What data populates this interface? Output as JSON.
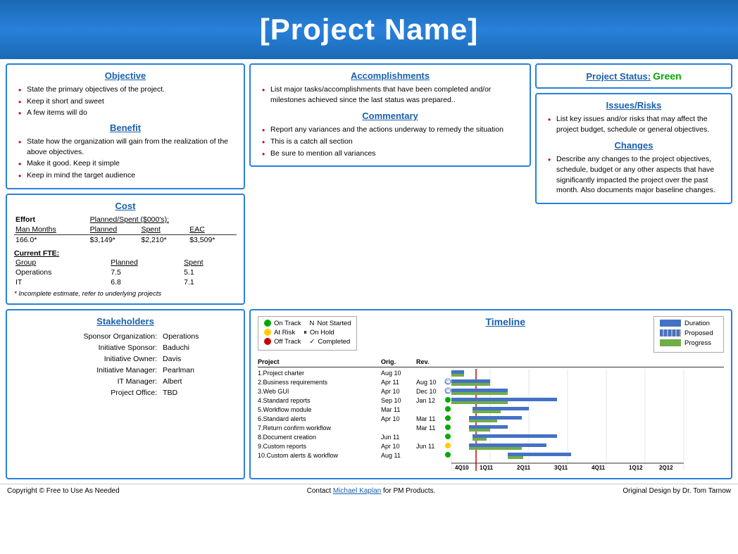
{
  "header": {
    "title": "[Project Name]"
  },
  "objective": {
    "title": "Objective",
    "items": [
      "State the primary objectives of the project.",
      "Keep it short and sweet",
      "A few items will do"
    ]
  },
  "benefit": {
    "title": "Benefit",
    "items": [
      "State how the organization will gain from the realization of the above objectives.",
      "Make it good. Keep it simple",
      "Keep in mind the target audience"
    ]
  },
  "accomplishments": {
    "title": "Accomplishments",
    "items": [
      "List major tasks/accomplishments that have been completed and/or milestones achieved  since the last status was prepared.."
    ]
  },
  "commentary": {
    "title": "Commentary",
    "items": [
      "Report any variances  and the actions underway to remedy the situation",
      "This is a catch all section",
      "Be  sure to mention all variances"
    ]
  },
  "project_status": {
    "title": "Project Status:",
    "value": "Green"
  },
  "issues_risks": {
    "title": "Issues/Risks",
    "items": [
      "List key issues and/or risks that may affect the project budget, schedule or general objectives."
    ]
  },
  "changes": {
    "title": "Changes",
    "items": [
      "Describe any changes to the project objectives, schedule, budget or any other aspects that have significantly impacted the project over the past month. Also documents major baseline changes."
    ]
  },
  "cost": {
    "title": "Cost",
    "effort_label": "Effort",
    "planned_spent_label": "Planned/Spent ($000's):",
    "columns": [
      "Man Months",
      "Planned",
      "Spent",
      "EAC"
    ],
    "row": [
      "166.0*",
      "$3,149*",
      "$2,210*",
      "$3,509*"
    ],
    "fte_label": "Current FTE:",
    "fte_columns": [
      "Group",
      "Planned",
      "Spent"
    ],
    "fte_rows": [
      [
        "Operations",
        "7.5",
        "5.1"
      ],
      [
        "IT",
        "6.8",
        "7.1"
      ]
    ],
    "footnote": "* Incomplete estimate, refer to underlying projects"
  },
  "stakeholders": {
    "title": "Stakeholders",
    "rows": [
      [
        "Sponsor Organization:",
        "Operations"
      ],
      [
        "Initiative Sponsor:",
        "Baduchi"
      ],
      [
        "Initiative Owner:",
        "Davis"
      ],
      [
        "Initiative Manager:",
        "Pearlman"
      ],
      [
        "IT Manager:",
        "Albert"
      ],
      [
        "Project Office:",
        "TBD"
      ]
    ]
  },
  "timeline": {
    "title": "Timeline",
    "legend_left": {
      "on_track": "On Track",
      "not_started": "Not Started",
      "at_risk": "At Risk",
      "on_hold": "On Hold",
      "off_track": "Off Track",
      "completed": "Completed"
    },
    "legend_right": {
      "duration": "Duration",
      "proposed": "Proposed",
      "progress": "Progress"
    },
    "columns": [
      "Project",
      "Orig.",
      "Rev."
    ],
    "quarters": [
      "4Q10",
      "1Q11",
      "2Q11",
      "3Q11",
      "4Q11",
      "1Q12",
      "2Q12"
    ],
    "projects": [
      {
        "name": "1.Project charter",
        "orig": "Aug 10",
        "rev": "",
        "status": "",
        "bar_start": 0,
        "bar_len": 1,
        "prog_len": 1
      },
      {
        "name": "2.Business requirements",
        "orig": "Apr 11",
        "rev": "Aug 10",
        "status": "completed",
        "bar_start": 0,
        "bar_len": 2,
        "prog_len": 2
      },
      {
        "name": "3.Web GUI",
        "orig": "Apr 10",
        "rev": "Dec 10",
        "status": "completed",
        "bar_start": 0,
        "bar_len": 3,
        "prog_len": 3
      },
      {
        "name": "4.Standard reports",
        "orig": "Sep 10",
        "rev": "Jan 12",
        "status": "green",
        "bar_start": 0,
        "bar_len": 5,
        "prog_len": 3
      },
      {
        "name": "5.Workflow module",
        "orig": "Mar 11",
        "rev": "",
        "status": "green",
        "bar_start": 1,
        "bar_len": 3,
        "prog_len": 2
      },
      {
        "name": "6.Standard alerts",
        "orig": "Apr 10",
        "rev": "Mar 11",
        "status": "green",
        "bar_start": 1,
        "bar_len": 3,
        "prog_len": 2
      },
      {
        "name": "7.Return confirm workflow",
        "orig": "",
        "rev": "Mar 11",
        "status": "green",
        "bar_start": 1,
        "bar_len": 2,
        "prog_len": 1
      },
      {
        "name": "8.Document creation",
        "orig": "Jun 11",
        "rev": "",
        "status": "green",
        "bar_start": 1,
        "bar_len": 4,
        "prog_len": 1
      },
      {
        "name": "9.Custom reports",
        "orig": "Apr 10",
        "rev": "Jun 11",
        "status": "at_risk",
        "bar_start": 1,
        "bar_len": 4,
        "prog_len": 3
      },
      {
        "name": "10.Custom alerts & workflow",
        "orig": "Aug 11",
        "rev": "",
        "status": "green",
        "bar_start": 2,
        "bar_len": 3,
        "prog_len": 1
      }
    ]
  },
  "footer": {
    "copyright": "Copyright © Free to  Use As Needed",
    "contact_pre": "Contact ",
    "contact_name": "Michael Kaplan",
    "contact_post": " for PM Products.",
    "design": "Original Design by Dr. Tom Tarnow"
  }
}
